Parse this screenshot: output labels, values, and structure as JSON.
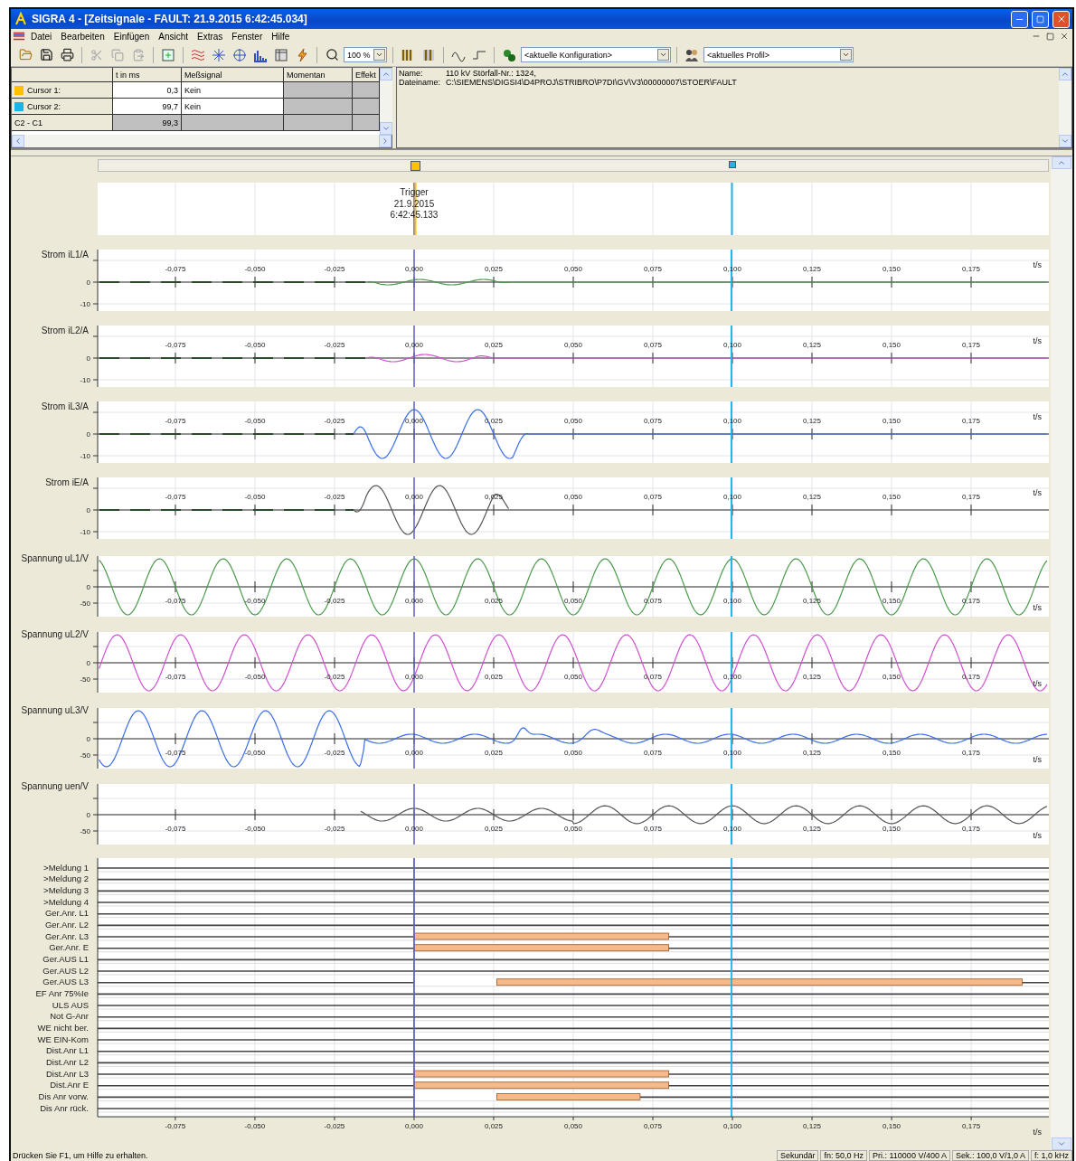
{
  "window": {
    "title": "SIGRA 4 - [Zeitsignale - FAULT: 21.9.2015 6:42:45.034]"
  },
  "menu": [
    "Datei",
    "Bearbeiten",
    "Einfügen",
    "Ansicht",
    "Extras",
    "Fenster",
    "Hilfe"
  ],
  "toolbar": {
    "zoom": "100 %",
    "configuration": "<aktuelle Konfiguration>",
    "profile": "<aktuelles Profil>"
  },
  "cursor_table": {
    "columns": [
      "t in ms",
      "Meßsignal",
      "Momentan",
      "Effekt"
    ],
    "rows": [
      {
        "label": "Cursor 1:",
        "color": "#ffc000",
        "t": "0,3",
        "signal": "Kein"
      },
      {
        "label": "Cursor 2:",
        "color": "#1eb4e6",
        "t": "99,7",
        "signal": "Kein"
      },
      {
        "label": "C2 - C1",
        "t": "99,3"
      }
    ]
  },
  "info": [
    {
      "key": "Name:",
      "value": "110 kV Störfall-Nr.:  1324,"
    },
    {
      "key": "Dateiname:",
      "value": "C:\\SIEMENS\\DIGSI4\\D4PROJ\\STRIBRO\\P7DI\\GV\\V3\\00000007\\STOER\\FAULT"
    }
  ],
  "trigger": {
    "lines": [
      "Trigger",
      "21.9.2015",
      "6:42:45.133"
    ]
  },
  "plots": [
    {
      "label": "Strom iL1/A",
      "kind": "current",
      "color": "#4a9a4a",
      "y_ticks": [
        "0",
        "-10"
      ],
      "x_ticks": [
        "-0,075",
        "-0,050",
        "-0,025",
        "0,000",
        "0,025",
        "0,050",
        "0,075",
        "0,100",
        "0,125",
        "0,150",
        "0,175"
      ],
      "x_unit": "t/s"
    },
    {
      "label": "Strom iL2/A",
      "kind": "current",
      "color": "#d050d0",
      "y_ticks": [
        "0",
        "-10"
      ],
      "x_ticks": [
        "-0,075",
        "-0,050",
        "-0,025",
        "0,000",
        "0,025",
        "0,050",
        "0,075",
        "0,100",
        "0,125",
        "0,150",
        "0,175"
      ],
      "x_unit": "t/s"
    },
    {
      "label": "Strom iL3/A",
      "kind": "current",
      "color": "#3a6ee8",
      "y_ticks": [
        "0",
        "-10"
      ],
      "x_ticks": [
        "-0,075",
        "-0,050",
        "-0,025",
        "0,000",
        "0,025",
        "0,050",
        "0,075",
        "0,100",
        "0,125",
        "0,150",
        "0,175"
      ],
      "x_unit": "t/s"
    },
    {
      "label": "Strom iE/A",
      "kind": "current",
      "color": "#555555",
      "y_ticks": [
        "0",
        "-10"
      ],
      "x_ticks": [
        "-0,075",
        "-0,050",
        "-0,025",
        "0,000",
        "0,025",
        "0,050",
        "0,075",
        "0,100",
        "0,125",
        "0,150",
        "0,175"
      ],
      "x_unit": "t/s"
    },
    {
      "label": "Spannung uL1/V",
      "kind": "voltage",
      "color": "#4a9a4a",
      "y_ticks": [
        "0",
        "-50"
      ],
      "x_ticks": [
        "-0,075",
        "-0,050",
        "-0,025",
        "0,000",
        "0,025",
        "0,050",
        "0,075",
        "0,100",
        "0,125",
        "0,150",
        "0,175"
      ],
      "x_unit": "t/s"
    },
    {
      "label": "Spannung uL2/V",
      "kind": "voltage",
      "color": "#d050d0",
      "y_ticks": [
        "0",
        "-50"
      ],
      "x_ticks": [
        "-0,075",
        "-0,050",
        "-0,025",
        "0,000",
        "0,025",
        "0,050",
        "0,075",
        "0,100",
        "0,125",
        "0,150",
        "0,175"
      ],
      "x_unit": "t/s"
    },
    {
      "label": "Spannung uL3/V",
      "kind": "voltage",
      "color": "#3a6ee8",
      "y_ticks": [
        "0",
        "-50"
      ],
      "x_ticks": [
        "-0,075",
        "-0,050",
        "-0,025",
        "0,000",
        "0,025",
        "0,050",
        "0,075",
        "0,100",
        "0,125",
        "0,150",
        "0,175"
      ],
      "x_unit": "t/s"
    },
    {
      "label": "Spannung uen/V",
      "kind": "voltage",
      "color": "#555555",
      "y_ticks": [
        "0",
        "-50"
      ],
      "x_ticks": [
        "-0,075",
        "-0,050",
        "-0,025",
        "0,000",
        "0,025",
        "0,050",
        "0,075",
        "0,100",
        "0,125",
        "0,150",
        "0,175"
      ],
      "x_unit": "t/s"
    }
  ],
  "binary": {
    "chart_data": {
      "type": "bar",
      "orientation": "horizontal",
      "stacked": true,
      "grid": true,
      "xlabel": "t/s",
      "xlim": [
        -0.0994,
        0.1994
      ],
      "ref_lines": [
        {
          "axis": "x",
          "value": 0,
          "color": "#6060c8"
        },
        {
          "axis": "x",
          "value": 0.0997,
          "color": "#1eb4e6"
        }
      ],
      "categories": [
        ">Meldung 1",
        ">Meldung 2",
        ">Meldung 3",
        ">Meldung 4",
        "Ger.Anr. L1",
        "Ger.Anr. L2",
        "Ger.Anr. L3",
        "Ger.Anr. E",
        "Ger.AUS L1",
        "Ger.AUS L2",
        "Ger.AUS L3",
        "EF Anr 75%Ie",
        "ULS AUS",
        "Not G-Anr",
        "WE nicht ber.",
        "WE EIN-Kom",
        "Dist.Anr L1",
        "Dist.Anr L2",
        "Dist.Anr L3",
        "Dist.Anr E",
        "Dis Anr vorw.",
        "Dis Anr rück."
      ],
      "series": [
        {
          "color": "#ffffff",
          "values": [
            null,
            null,
            null,
            null,
            null,
            null,
            0,
            0,
            null,
            null,
            0.026,
            null,
            null,
            null,
            null,
            null,
            null,
            null,
            0,
            0,
            0.026,
            null
          ]
        },
        {
          "color": "#f5b98a",
          "values": [
            null,
            null,
            null,
            null,
            null,
            null,
            0.08,
            0.08,
            null,
            null,
            0.165,
            null,
            null,
            null,
            null,
            null,
            null,
            null,
            0.08,
            0.08,
            0.045,
            null
          ]
        }
      ],
      "xticks": [
        {
          "value": -0.075,
          "label": "-0,075"
        },
        {
          "value": -0.05,
          "label": "-0,050"
        },
        {
          "value": -0.025,
          "label": "-0,025"
        },
        {
          "value": 0,
          "label": "0,000"
        },
        {
          "value": 0.025,
          "label": "0,025"
        },
        {
          "value": 0.05,
          "label": "0,050"
        },
        {
          "value": 0.075,
          "label": "0,075"
        },
        {
          "value": 0.1,
          "label": "0,100"
        },
        {
          "value": 0.125,
          "label": "0,125"
        },
        {
          "value": 0.15,
          "label": "0,150"
        },
        {
          "value": 0.175,
          "label": "0,175"
        }
      ]
    }
  },
  "status_bar": {
    "hint": "Drücken Sie F1, um Hilfe zu erhalten.",
    "panes": [
      "Sekundär",
      "fn: 50,0 Hz",
      "Pri.: 110000 V/400 A",
      "Sek.: 100,0 V/1,0 A",
      "f: 1,0 kHz"
    ]
  }
}
